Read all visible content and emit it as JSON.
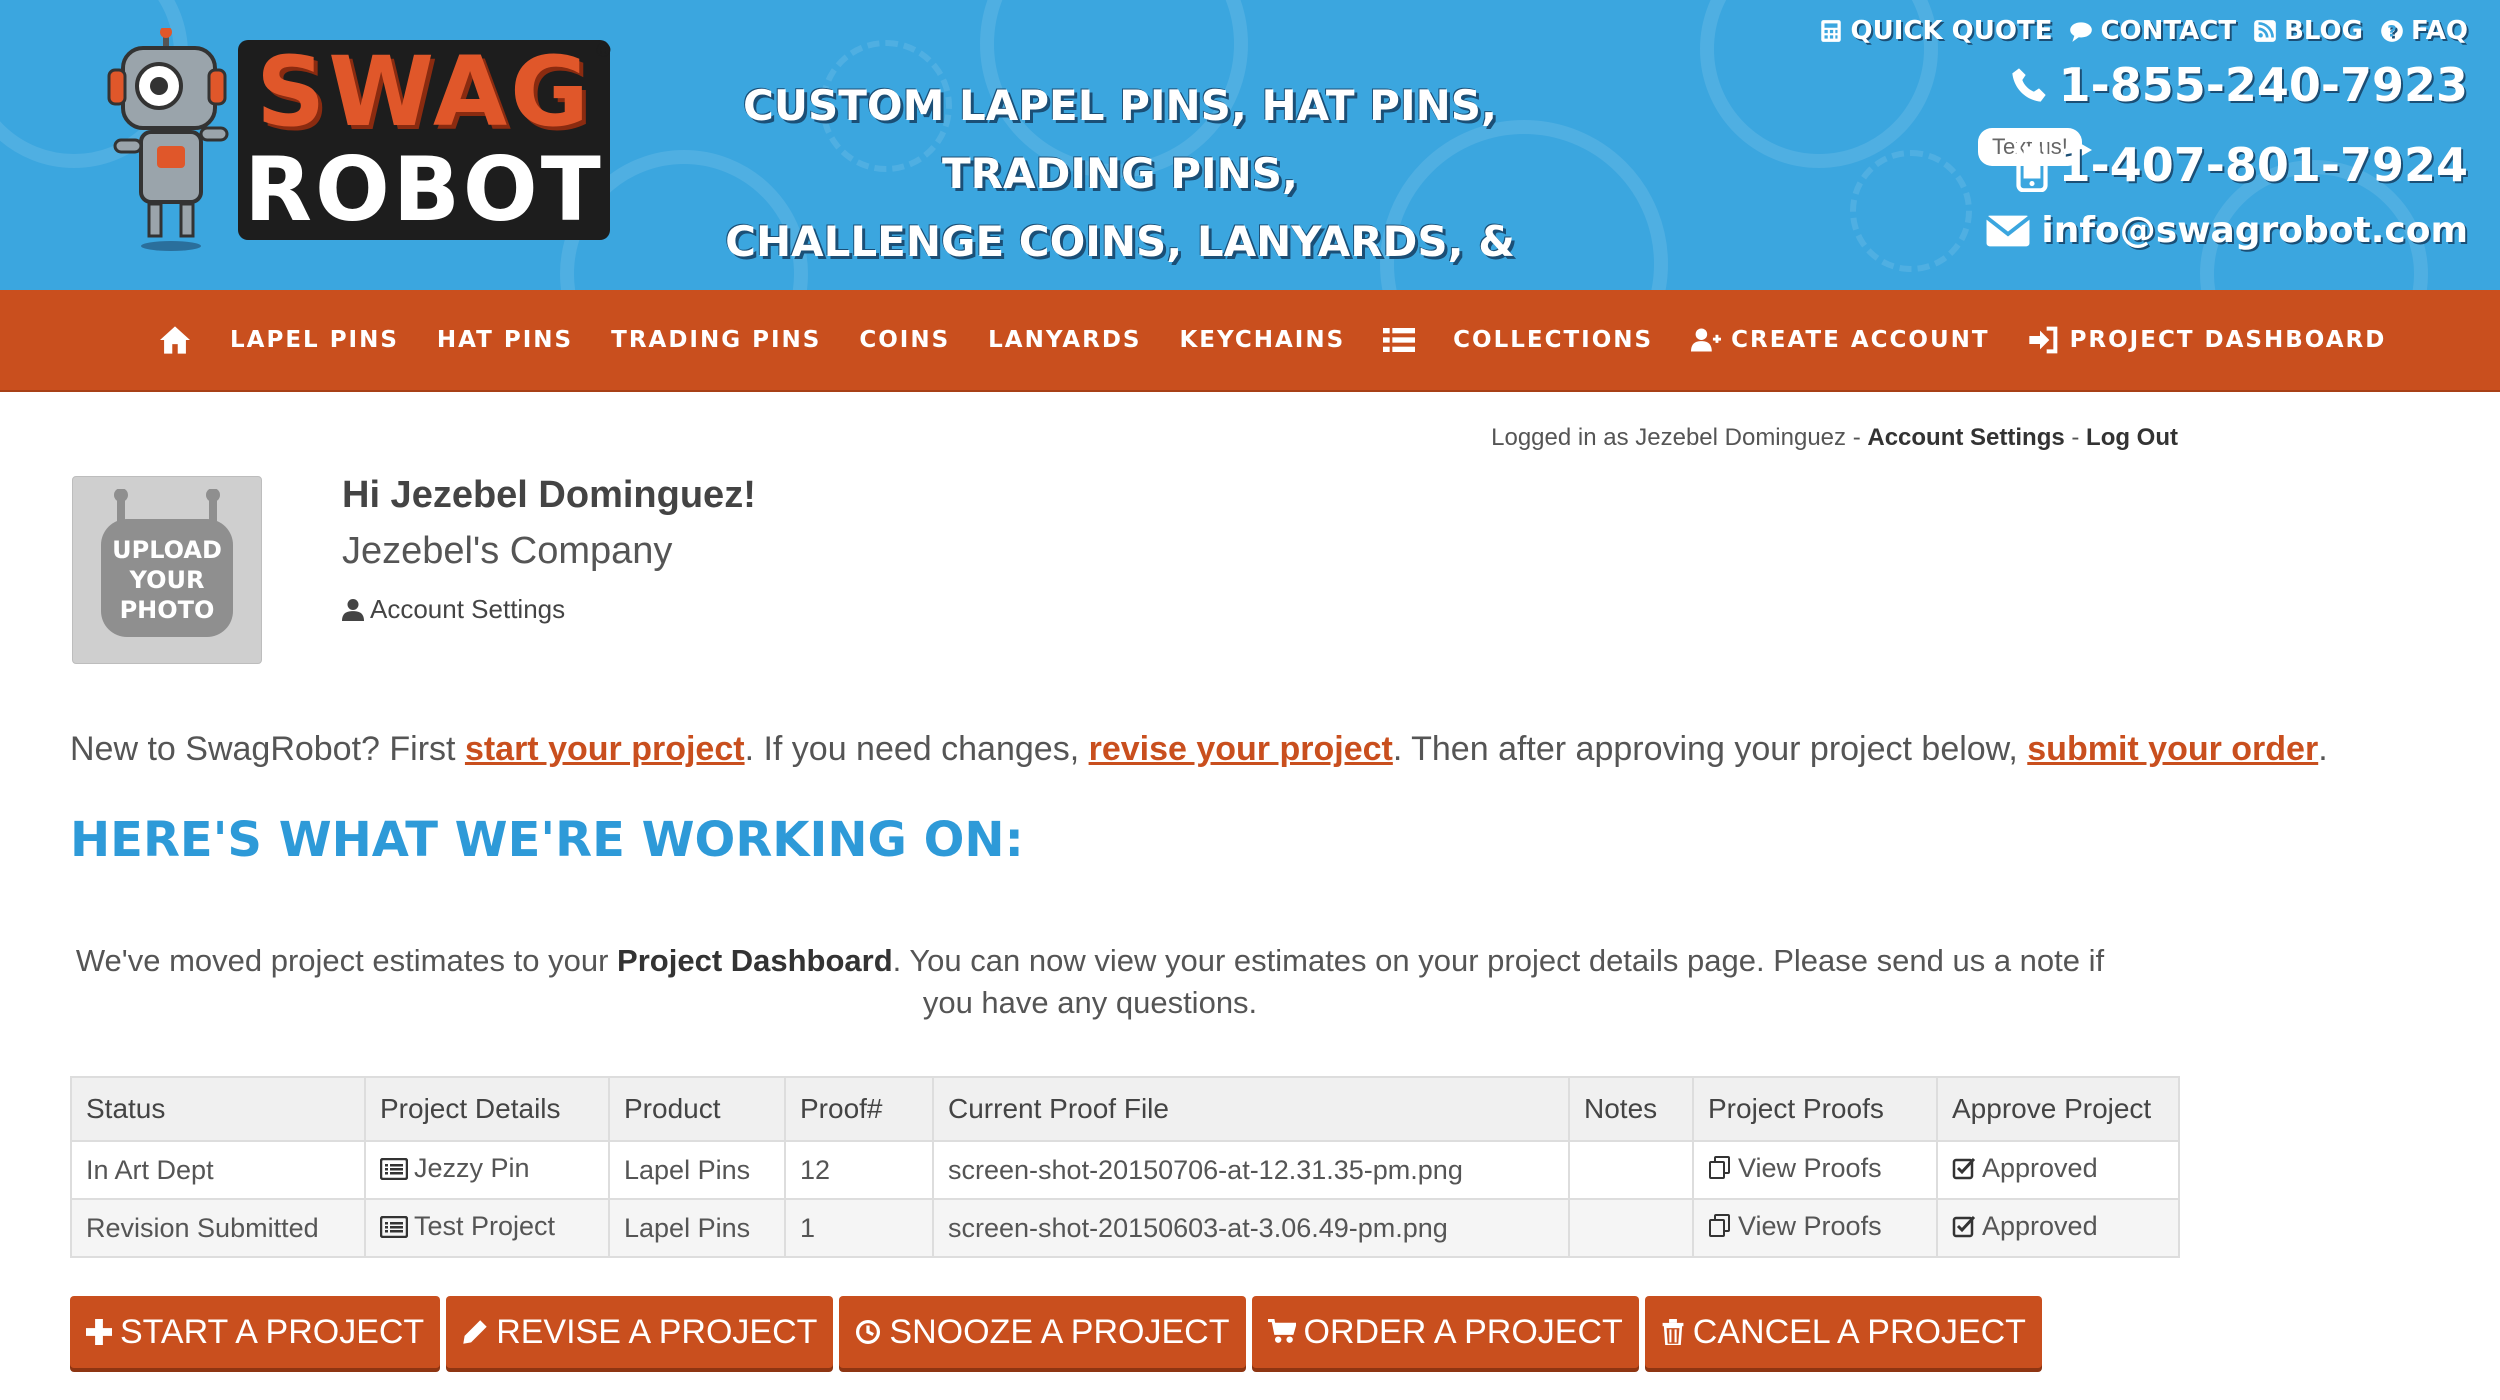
{
  "header": {
    "logo_word_top": "SWAG",
    "logo_word_bottom": "ROBOT",
    "logo_reg": "®",
    "tagline_line1": "CUSTOM LAPEL PINS, HAT PINS, TRADING PINS,",
    "tagline_line2": "CHALLENGE COINS, LANYARDS, & KEYCHAINS!",
    "top_links": {
      "quick_quote": "QUICK QUOTE",
      "contact": "CONTACT",
      "blog": "BLOG",
      "faq": "FAQ"
    },
    "phone1": "1-855-240-7923",
    "phone2": "1-407-801-7924",
    "text_us": "Text us!",
    "email": "info@swagrobot.com"
  },
  "nav": {
    "lapel_pins": "LAPEL PINS",
    "hat_pins": "HAT PINS",
    "trading_pins": "TRADING PINS",
    "coins": "COINS",
    "lanyards": "LANYARDS",
    "keychains": "KEYCHAINS",
    "collections": "COLLECTIONS",
    "create_account": "CREATE ACCOUNT",
    "project_dashboard": "PROJECT DASHBOARD"
  },
  "session": {
    "logged_in_as": "Logged in as Jezebel Dominguez - ",
    "account_settings": "Account Settings",
    "separator": " - ",
    "log_out": "Log Out"
  },
  "profile": {
    "photo_line1": "UPLOAD",
    "photo_line2": "YOUR",
    "photo_line3": "PHOTO",
    "greeting": "Hi Jezebel Dominguez!",
    "company": "Jezebel's Company",
    "account_settings": "Account Settings"
  },
  "intro": {
    "part1": "New to SwagRobot? First ",
    "link1": "start your project",
    "part2": ". If you need changes, ",
    "link2": "revise your project",
    "part3": ". Then after approving your project below, ",
    "link3": "submit your order",
    "part4": "."
  },
  "section_title": "HERE'S WHAT WE'RE WORKING ON:",
  "notice": {
    "part1": "We've moved project estimates to your ",
    "strong": "Project Dashboard",
    "part2": ". You can now view your estimates on your project details page. Please send us a note if you have any questions."
  },
  "table": {
    "headers": [
      "Status",
      "Project Details",
      "Product",
      "Proof#",
      "Current Proof File",
      "Notes",
      "Project Proofs",
      "Approve Project"
    ],
    "rows": [
      {
        "status": "In Art Dept",
        "details": "Jezzy Pin",
        "product": "Lapel Pins",
        "proof_num": "12",
        "file": "screen-shot-20150706-at-12.31.35-pm.png",
        "notes": "",
        "proofs": "View Proofs",
        "approve": "Approved"
      },
      {
        "status": "Revision Submitted",
        "details": "Test Project",
        "product": "Lapel Pins",
        "proof_num": "1",
        "file": "screen-shot-20150603-at-3.06.49-pm.png",
        "notes": "",
        "proofs": "View Proofs",
        "approve": "Approved"
      }
    ]
  },
  "buttons": {
    "start": "START A PROJECT",
    "revise": "REVISE A PROJECT",
    "snooze": "SNOOZE A PROJECT",
    "order": "ORDER A PROJECT",
    "cancel": "CANCEL A PROJECT"
  },
  "colors": {
    "header_blue": "#3ba6df",
    "nav_orange": "#c94f1e",
    "title_blue": "#2e9ad8"
  }
}
